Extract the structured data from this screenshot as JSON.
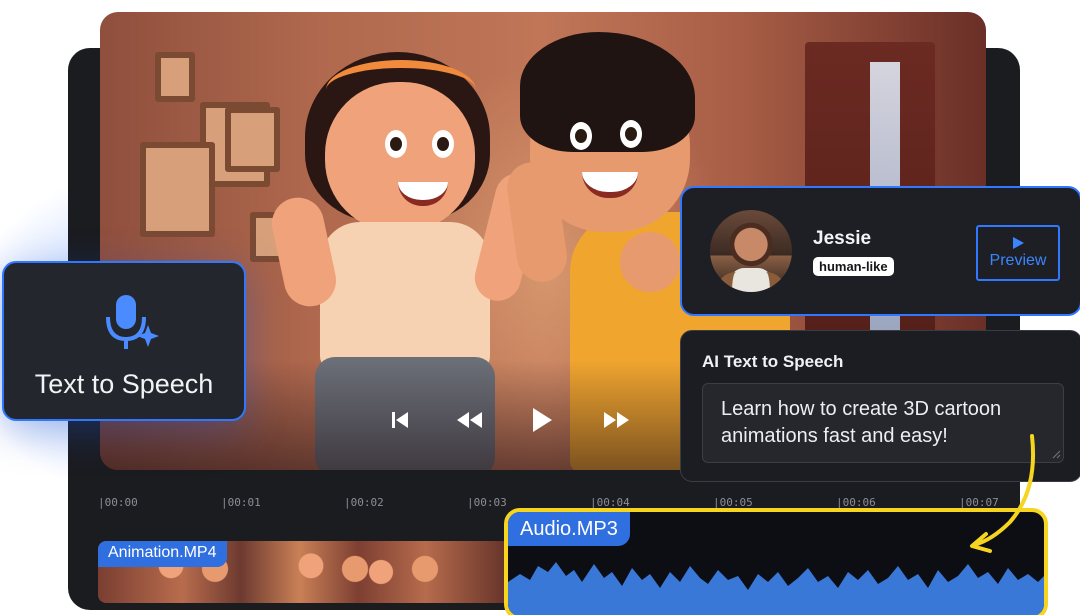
{
  "tts_card": {
    "title": "Text to Speech",
    "icon": "microphone-sparkle-icon"
  },
  "voice": {
    "name": "Jessie",
    "tag": "human-like",
    "preview_label": "Preview"
  },
  "ai_panel": {
    "title": "AI Text to Speech",
    "text": "Learn how to create 3D cartoon animations fast and easy!"
  },
  "timeline": {
    "ticks": [
      "|00:00",
      "|00:01",
      "|00:02",
      "|00:03",
      "|00:04",
      "|00:05",
      "|00:06",
      "|00:07"
    ]
  },
  "clips": {
    "animation_label": "Animation.MP4",
    "audio_label": "Audio.MP3"
  },
  "controls": [
    "skip-back-icon",
    "rewind-icon",
    "play-icon",
    "fast-forward-icon"
  ],
  "colors": {
    "accent": "#2f78ff",
    "highlight": "#f5d51f",
    "panel": "#1b1d22"
  }
}
